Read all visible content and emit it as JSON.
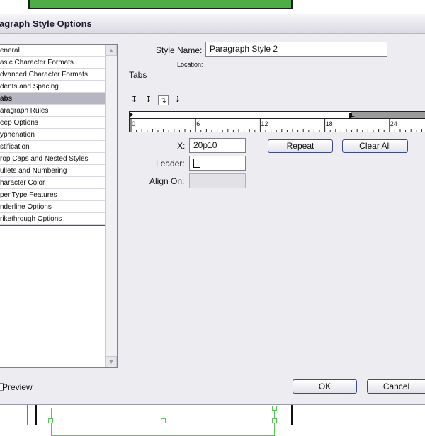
{
  "dialog": {
    "title": "agraph Style Options"
  },
  "sidebar": {
    "items": [
      {
        "label": "eneral"
      },
      {
        "label": "asic Character Formats"
      },
      {
        "label": "dvanced Character Formats"
      },
      {
        "label": "dents and Spacing"
      },
      {
        "label": "abs"
      },
      {
        "label": "aragraph Rules"
      },
      {
        "label": "eep Options"
      },
      {
        "label": "yphenation"
      },
      {
        "label": "stification"
      },
      {
        "label": "rop Caps and Nested Styles"
      },
      {
        "label": "ullets and Numbering"
      },
      {
        "label": "haracter Color"
      },
      {
        "label": "penType Features"
      },
      {
        "label": "nderline Options"
      },
      {
        "label": "rikethrough Options"
      }
    ],
    "selected_index": 4,
    "scroll_up": "▲",
    "scroll_down": "▼"
  },
  "style_name": {
    "label": "Style Name:",
    "value": "Paragraph Style 2",
    "location_label": "Location:"
  },
  "tabs_section": {
    "heading": "Tabs",
    "alignment_icons": [
      "↧",
      "↧",
      "↴",
      "⇣"
    ],
    "active_icon_index": 2
  },
  "ruler": {
    "numbers": [
      "0",
      "6",
      "12",
      "18",
      "24"
    ]
  },
  "tab_settings": {
    "x_label": "X:",
    "x_value": "20p10",
    "leader_label": "Leader:",
    "leader_value": "",
    "align_on_label": "Align On:",
    "align_on_value": "",
    "repeat_label": "Repeat",
    "clear_all_label": "Clear All"
  },
  "footer": {
    "preview_label": "Preview",
    "ok_label": "OK",
    "cancel_label": "Cancel"
  },
  "colors": {
    "document_green": "#4fae43",
    "selection_green": "#56c856",
    "list_selection": "#b6b6c2"
  }
}
